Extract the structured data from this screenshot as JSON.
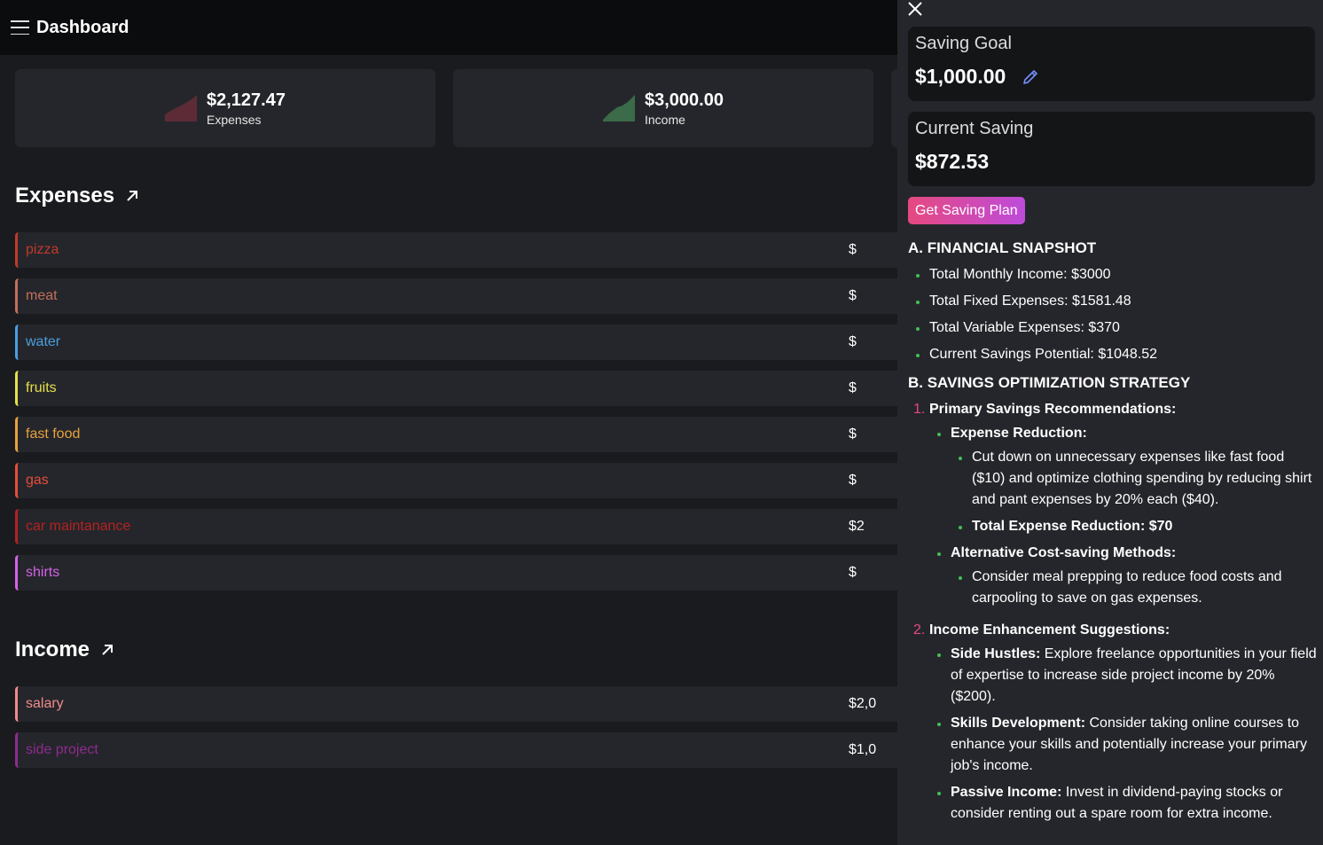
{
  "header": {
    "title": "Dashboard"
  },
  "cards": [
    {
      "amount": "$2,127.47",
      "label": "Expenses",
      "color": "#5c2b35"
    },
    {
      "amount": "$3,000.00",
      "label": "Income",
      "color": "#3b6b48"
    }
  ],
  "expenses": {
    "title": "Expenses",
    "items": [
      {
        "name": "pizza",
        "value": "$",
        "color": "#c0392b"
      },
      {
        "name": "meat",
        "value": "$",
        "color": "#c2705a"
      },
      {
        "name": "water",
        "value": "$",
        "color": "#4a9fe0"
      },
      {
        "name": "fruits",
        "value": "$",
        "color": "#e5e04a"
      },
      {
        "name": "fast food",
        "value": "$",
        "color": "#e6a23c"
      },
      {
        "name": "gas",
        "value": "$",
        "color": "#e74c3c"
      },
      {
        "name": "car maintanance",
        "value": "$2",
        "color": "#b22222"
      },
      {
        "name": "shirts",
        "value": "$",
        "color": "#d463e8"
      }
    ]
  },
  "income": {
    "title": "Income",
    "items": [
      {
        "name": "salary",
        "value": "$2,0",
        "color": "#f08b8b"
      },
      {
        "name": "side project",
        "value": "$1,0",
        "color": "#8e2b8e"
      }
    ]
  },
  "drawer": {
    "goal_label": "Saving Goal",
    "goal_value": "$1,000.00",
    "current_label": "Current Saving",
    "current_value": "$872.53",
    "plan_button": "Get Saving Plan",
    "plan": {
      "a_title": "A. FINANCIAL SNAPSHOT",
      "snapshot": [
        "Total Monthly Income: $3000",
        "Total Fixed Expenses: $1581.48",
        "Total Variable Expenses: $370",
        "Current Savings Potential: $1048.52"
      ],
      "b_title": "B. SAVINGS OPTIMIZATION STRATEGY",
      "s1_num": "1.",
      "s1_title": "Primary Savings Recommendations:",
      "s1_a_title": "Expense Reduction:",
      "s1_a_1": "Cut down on unnecessary expenses like fast food ($10) and optimize clothing spending by reducing shirt and pant expenses by 20% each ($40).",
      "s1_a_2": "Total Expense Reduction: $70",
      "s1_b_title": "Alternative Cost-saving Methods:",
      "s1_b_1": "Consider meal prepping to reduce food costs and carpooling to save on gas expenses.",
      "s2_num": "2.",
      "s2_title": "Income Enhancement Suggestions:",
      "s2_a_bold": "Side Hustles:",
      "s2_a_text": " Explore freelance opportunities in your field of expertise to increase side project income by 20% ($200).",
      "s2_b_bold": "Skills Development:",
      "s2_b_text": " Consider taking online courses to enhance your skills and potentially increase your primary job's income.",
      "s2_c_bold": "Passive Income:",
      "s2_c_text": " Invest in dividend-paying stocks or consider renting out a spare room for extra income."
    }
  }
}
